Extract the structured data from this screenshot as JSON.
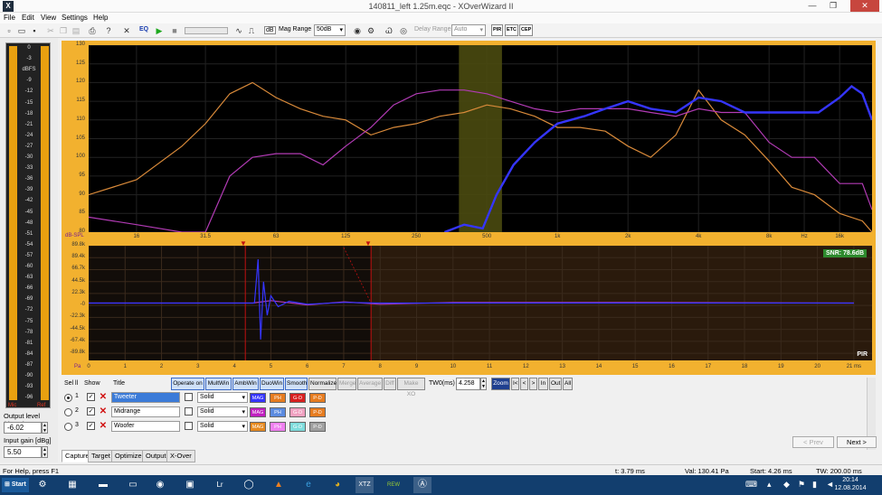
{
  "window": {
    "title": "140811_left 1.25m.eqc - XOverWizard II"
  },
  "menu": [
    "File",
    "Edit",
    "View",
    "Settings",
    "Help"
  ],
  "toolbar": {
    "eq_label": "EQ",
    "db_label": "dB",
    "mag_range_label": "Mag Range",
    "mag_range_value": "50dB",
    "delay_range_label": "Delay Range",
    "delay_range_value": "Auto",
    "pir_label": "PIR",
    "etc_label": "ETC",
    "cep_label": "CEP"
  },
  "meter": {
    "scale": [
      "0",
      "-3",
      "dBFS",
      "-9",
      "-12",
      "-15",
      "-18",
      "-21",
      "-24",
      "-27",
      "-30",
      "-33",
      "-36",
      "-39",
      "-42",
      "-45",
      "-48",
      "-51",
      "-54",
      "-57",
      "-60",
      "-63",
      "-66",
      "-69",
      "-72",
      "-75",
      "-78",
      "-81",
      "-84",
      "-87",
      "-90",
      "-93",
      "-96"
    ],
    "mic_label": "Mic",
    "ref_label": "Ref",
    "bar_color": "#e8a010"
  },
  "levels": {
    "output_label": "Output level (dBFS)",
    "output_value": "-6.02",
    "input_label": "Input gain [dBg]",
    "input_value": "5.50"
  },
  "mag_axis": {
    "y_ticks": [
      "130",
      "125",
      "120",
      "115",
      "110",
      "105",
      "100",
      "95",
      "90",
      "85",
      "80"
    ],
    "y_unit": "dB-SPL",
    "x_ticks": [
      "16",
      "31.5",
      "63",
      "125",
      "250",
      "500",
      "1k",
      "2k",
      "4k",
      "8k",
      "Hz",
      "16k"
    ]
  },
  "imp_axis": {
    "y_ticks": [
      "89.8k",
      "89.4k",
      "66.7k",
      "44.5k",
      "22.3k",
      "-0",
      "-22.3k",
      "-44.5k",
      "-67.4k",
      "-89.8k"
    ],
    "x_unit": "Pa",
    "x_ticks": [
      "0",
      "1",
      "2",
      "3",
      "4",
      "5",
      "6",
      "7",
      "8",
      "9",
      "10",
      "11",
      "12",
      "13",
      "14",
      "15",
      "16",
      "17",
      "18",
      "19",
      "20",
      "21 ms"
    ],
    "snr": "SNR: 78.6dB",
    "pir": "PIR"
  },
  "chart_data": [
    {
      "type": "line",
      "title": "",
      "xlabel": "Hz",
      "ylabel": "dB-SPL",
      "x_scale": "log",
      "xlim": [
        10,
        22000
      ],
      "ylim": [
        80,
        130
      ],
      "series": [
        {
          "name": "Tweeter",
          "color": "#3535ff",
          "x": [
            330,
            400,
            480,
            550,
            650,
            800,
            1000,
            1300,
            1600,
            2000,
            2500,
            3200,
            4000,
            5000,
            6300,
            8000,
            10000,
            13000,
            16000,
            18000,
            20000,
            22000
          ],
          "y": [
            80,
            82,
            81,
            90,
            98,
            104,
            109,
            111,
            113,
            115,
            113,
            112,
            116,
            115,
            112,
            112,
            112,
            112,
            116,
            119,
            117,
            110
          ]
        },
        {
          "name": "Midrange",
          "color": "#b23bb5",
          "x": [
            10,
            16,
            25,
            31.5,
            40,
            50,
            63,
            80,
            100,
            125,
            160,
            200,
            250,
            315,
            400,
            500,
            630,
            800,
            1000,
            1250,
            1600,
            2000,
            2500,
            3200,
            4000,
            5000,
            6300,
            8000,
            10000,
            12500,
            16000,
            20000,
            22000
          ],
          "y": [
            84,
            82,
            80,
            80,
            95,
            100,
            101,
            101,
            98,
            103,
            108,
            114,
            117,
            118,
            118,
            117,
            115,
            113,
            112,
            113,
            113,
            113,
            112,
            111,
            113,
            112,
            112,
            104,
            100,
            100,
            93,
            93,
            86
          ]
        },
        {
          "name": "Woofer",
          "color": "#d98a3a",
          "x": [
            10,
            16,
            25,
            31.5,
            40,
            50,
            63,
            80,
            100,
            125,
            160,
            200,
            250,
            315,
            400,
            500,
            630,
            800,
            1000,
            1250,
            1600,
            2000,
            2500,
            3200,
            4000,
            5000,
            6300,
            8000,
            10000,
            12500,
            16000,
            20000,
            22000
          ],
          "y": [
            90,
            94,
            103,
            109,
            117,
            120,
            116,
            113,
            111,
            110,
            106,
            108,
            109,
            111,
            112,
            114,
            113,
            111,
            108,
            108,
            107,
            103,
            100,
            106,
            118,
            110,
            106,
            99,
            92,
            90,
            85,
            83,
            80
          ]
        }
      ]
    },
    {
      "type": "line",
      "title": "",
      "xlabel": "ms",
      "ylabel": "Pa",
      "xlim": [
        0,
        21
      ],
      "ylim": [
        -89.8,
        89.8
      ],
      "series": [
        {
          "name": "Tweeter",
          "color": "#3535ff",
          "x": [
            0,
            4.0,
            4.3,
            4.55,
            4.65,
            4.72,
            4.8,
            4.9,
            5.0,
            5.2,
            5.5,
            6.0,
            7.0,
            8.0,
            10,
            15,
            21
          ],
          "y": [
            0,
            0,
            0,
            0,
            72,
            -60,
            35,
            -20,
            12,
            -6,
            3,
            -2,
            1,
            0,
            0,
            0,
            0
          ]
        },
        {
          "name": "Midrange",
          "color": "#b23bb5",
          "x": [
            0,
            4.5,
            5.0,
            6.0,
            7.0,
            8.0,
            10,
            15,
            21
          ],
          "y": [
            0,
            0,
            4,
            -3,
            2,
            -2,
            1,
            1,
            0
          ]
        }
      ]
    }
  ],
  "trace_strip": {
    "sel_label": "Sel ll",
    "show_label": "Show",
    "title_label": "Title",
    "buttons": [
      "Operate on",
      "MultWin",
      "AmbWin",
      "DuoWin",
      "Smooth",
      "Normalize",
      "Merge",
      "Average",
      "Diff",
      "Make XO"
    ],
    "tw_label": "TW0(ms)",
    "tw_value": "4.258",
    "zoom_label": "Zoom",
    "nav_buttons": [
      "I<",
      "<",
      ">",
      "In",
      "Out",
      "All"
    ]
  },
  "traces": [
    {
      "num": "1",
      "title": "Tweeter",
      "style": "Solid",
      "mag_color": "#3535ff",
      "ph_color": "#e67c20",
      "gd_color": "#d82020",
      "pd_color": "#e67c20",
      "selected": true
    },
    {
      "num": "2",
      "title": "Midrange",
      "style": "Solid",
      "mag_color": "#c020c0",
      "ph_color": "#5b8be0",
      "gd_color": "#f0a0c0",
      "pd_color": "#e67c20",
      "selected": false
    },
    {
      "num": "3",
      "title": "Woofer",
      "style": "Solid",
      "mag_color": "#e68a20",
      "ph_color": "#f080f0",
      "gd_color": "#7fdcdc",
      "pd_color": "#a0a0a0",
      "selected": false
    }
  ],
  "trace_buttons": {
    "mag": "MAG",
    "ph": "PH",
    "gd": "G-D",
    "pd": "P-D"
  },
  "tabs": [
    "Capture",
    "Target",
    "Optimizer",
    "Output",
    "X-Over"
  ],
  "nav": {
    "prev": "< Prev",
    "next": "Next >"
  },
  "status": {
    "help": "For Help, press F1",
    "t": "t: 3.79 ms",
    "val": "Val: 130.41 Pa",
    "start": "Start: 4.26 ms",
    "tw": "TW: 200.00 ms"
  },
  "taskbar": {
    "start_label": "Start",
    "clock_time": "20:14",
    "clock_date": "12.08.2014"
  }
}
